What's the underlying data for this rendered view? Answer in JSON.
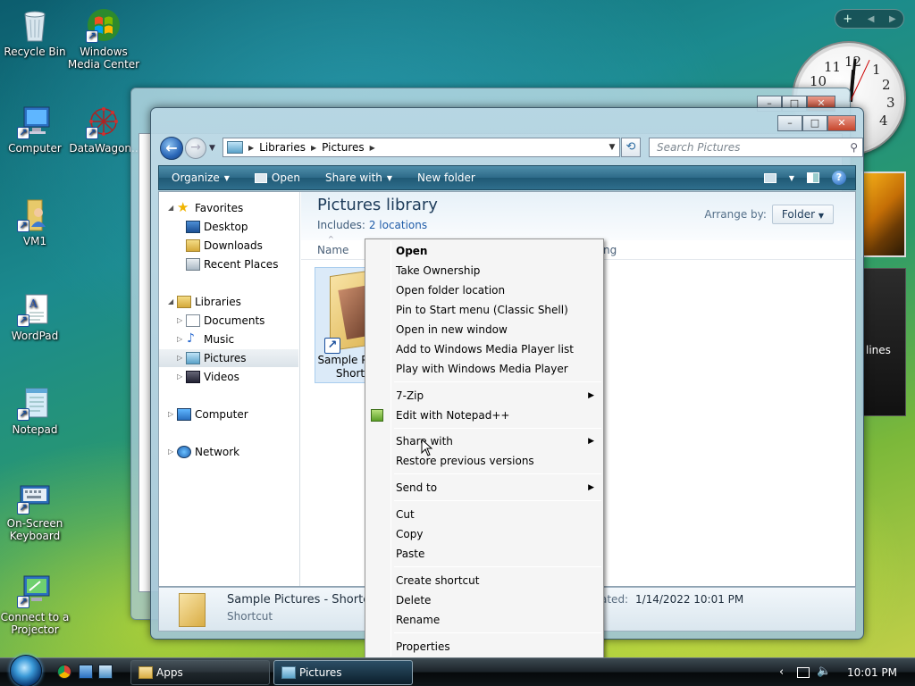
{
  "desktop": {
    "icons": [
      {
        "label": "Recycle Bin"
      },
      {
        "label": "Windows Media Center"
      },
      {
        "label": "Computer"
      },
      {
        "label": "DataWagon.."
      },
      {
        "label": "VM1"
      },
      {
        "label": "WordPad"
      },
      {
        "label": "Notepad"
      },
      {
        "label": "On-Screen Keyboard"
      },
      {
        "label": "Connect to a Projector"
      }
    ]
  },
  "gadgets": {
    "feed_text": "lines",
    "clock_numbers": [
      "12",
      "1",
      "2",
      "3",
      "4",
      "10",
      "11"
    ]
  },
  "explorer": {
    "address": {
      "segments": [
        "Libraries",
        "Pictures"
      ]
    },
    "search_placeholder": "Search Pictures",
    "toolbar": {
      "organize": "Organize",
      "open": "Open",
      "share_with": "Share with",
      "new_folder": "New folder"
    },
    "nav": {
      "favorites": "Favorites",
      "desktop": "Desktop",
      "downloads": "Downloads",
      "recent_places": "Recent Places",
      "libraries": "Libraries",
      "documents": "Documents",
      "music": "Music",
      "pictures": "Pictures",
      "videos": "Videos",
      "computer": "Computer",
      "network": "Network"
    },
    "library": {
      "title": "Pictures library",
      "includes_label": "Includes:",
      "includes_value": "2 locations",
      "arrange_by_label": "Arrange by:",
      "arrange_by_value": "Folder"
    },
    "columns": {
      "name": "Name",
      "rating_partial": "ting"
    },
    "file": {
      "line1": "Sample Pi",
      "line2": "Short"
    },
    "details": {
      "name": "Sample Pictures - Shortcut",
      "type": "Shortcut",
      "date_label_partial": "ated:",
      "date_value": "1/14/2022 10:01 PM"
    }
  },
  "context_menu": {
    "items": [
      {
        "label": "Open",
        "bold": true
      },
      {
        "label": "Take Ownership"
      },
      {
        "label": "Open folder location"
      },
      {
        "label": "Pin to Start menu (Classic Shell)"
      },
      {
        "label": "Open in new window"
      },
      {
        "label": "Add to Windows Media Player list"
      },
      {
        "label": "Play with Windows Media Player"
      },
      {
        "label": "7-Zip",
        "submenu": true
      },
      {
        "label": "Edit with Notepad++"
      },
      {
        "label": "Share with",
        "submenu": true
      },
      {
        "label": "Restore previous versions"
      },
      {
        "label": "Send to",
        "submenu": true
      },
      {
        "label": "Cut"
      },
      {
        "label": "Copy"
      },
      {
        "label": "Paste"
      },
      {
        "label": "Create shortcut"
      },
      {
        "label": "Delete"
      },
      {
        "label": "Rename"
      },
      {
        "label": "Properties"
      }
    ]
  },
  "taskbar": {
    "buttons": [
      {
        "label": "Apps",
        "active": false
      },
      {
        "label": "Pictures",
        "active": true
      }
    ],
    "clock": "10:01 PM"
  }
}
